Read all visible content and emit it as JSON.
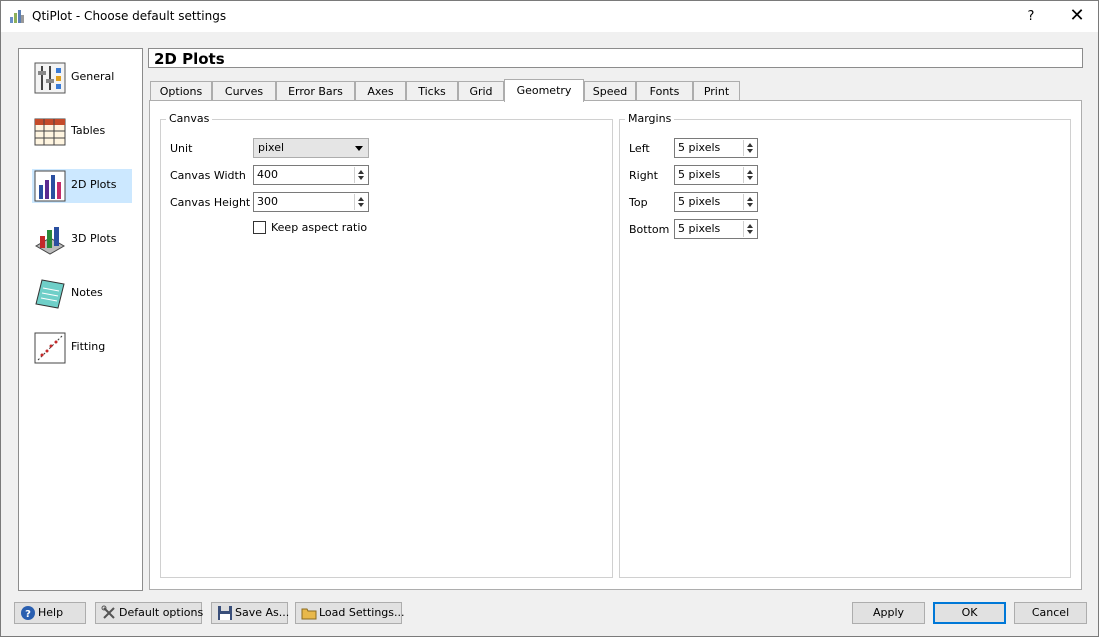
{
  "window": {
    "title": "QtiPlot - Choose default settings",
    "help_glyph": "?",
    "close_glyph": "✕"
  },
  "sidebar": {
    "items": [
      {
        "label": "General",
        "icon": "general-settings-icon"
      },
      {
        "label": "Tables",
        "icon": "table-icon"
      },
      {
        "label": "2D Plots",
        "icon": "bar-chart-icon",
        "active": true
      },
      {
        "label": "3D Plots",
        "icon": "3d-plot-icon"
      },
      {
        "label": "Notes",
        "icon": "notes-icon"
      },
      {
        "label": "Fitting",
        "icon": "fitting-icon"
      }
    ]
  },
  "header": {
    "title": "2D Plots"
  },
  "tabs": [
    "Options",
    "Curves",
    "Error Bars",
    "Axes",
    "Ticks",
    "Grid",
    "Geometry",
    "Speed",
    "Fonts",
    "Print"
  ],
  "active_tab": "Geometry",
  "canvas": {
    "title": "Canvas",
    "unit_label": "Unit",
    "unit_value": "pixel",
    "width_label": "Canvas Width",
    "width_value": "400",
    "height_label": "Canvas Height",
    "height_value": "300",
    "aspect_label": "Keep aspect ratio",
    "aspect_checked": false
  },
  "margins": {
    "title": "Margins",
    "left_label": "Left",
    "left_value": "5 pixels",
    "right_label": "Right",
    "right_value": "5 pixels",
    "top_label": "Top",
    "top_value": "5 pixels",
    "bottom_label": "Bottom",
    "bottom_value": "5 pixels"
  },
  "buttons": {
    "help": "Help",
    "default_options": "Default options",
    "save_as": "Save As...",
    "load_settings": "Load Settings...",
    "apply": "Apply",
    "ok": "OK",
    "cancel": "Cancel"
  },
  "colors": {
    "accent": "#0078d7",
    "selected_bg": "#cce8ff"
  }
}
